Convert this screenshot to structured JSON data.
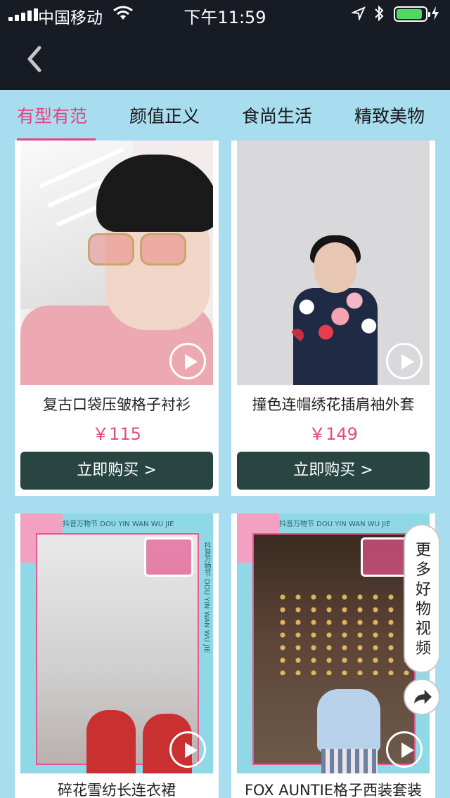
{
  "status": {
    "carrier": "中国移动",
    "time": "下午11:59",
    "battery_level": 0.9
  },
  "tabs": [
    {
      "label": "有型有范",
      "active": true
    },
    {
      "label": "颜值正义",
      "active": false
    },
    {
      "label": "食尚生活",
      "active": false
    },
    {
      "label": "精致美物",
      "active": false
    }
  ],
  "products": [
    {
      "name": "复古口袋压皱格子衬衫",
      "price": "￥115",
      "buy": "立即购买 >"
    },
    {
      "name": "撞色连帽绣花插肩袖外套",
      "price": "￥149",
      "buy": "立即购买 >"
    },
    {
      "name": "碎花雪纺长连衣裙"
    },
    {
      "name": "FOX AUNTIE格子西装套装"
    }
  ],
  "festival": {
    "banner": "抖音万物节  DOU YIN WAN WU JIE",
    "side": "抖音万物节 DOU YIN WAN WU JIE"
  },
  "more_videos": "更多好物视频",
  "colors": {
    "accent": "#e8427c",
    "price": "#e34b7f",
    "buy_button": "#284542",
    "background": "#a8dcef",
    "header": "#161b24"
  }
}
